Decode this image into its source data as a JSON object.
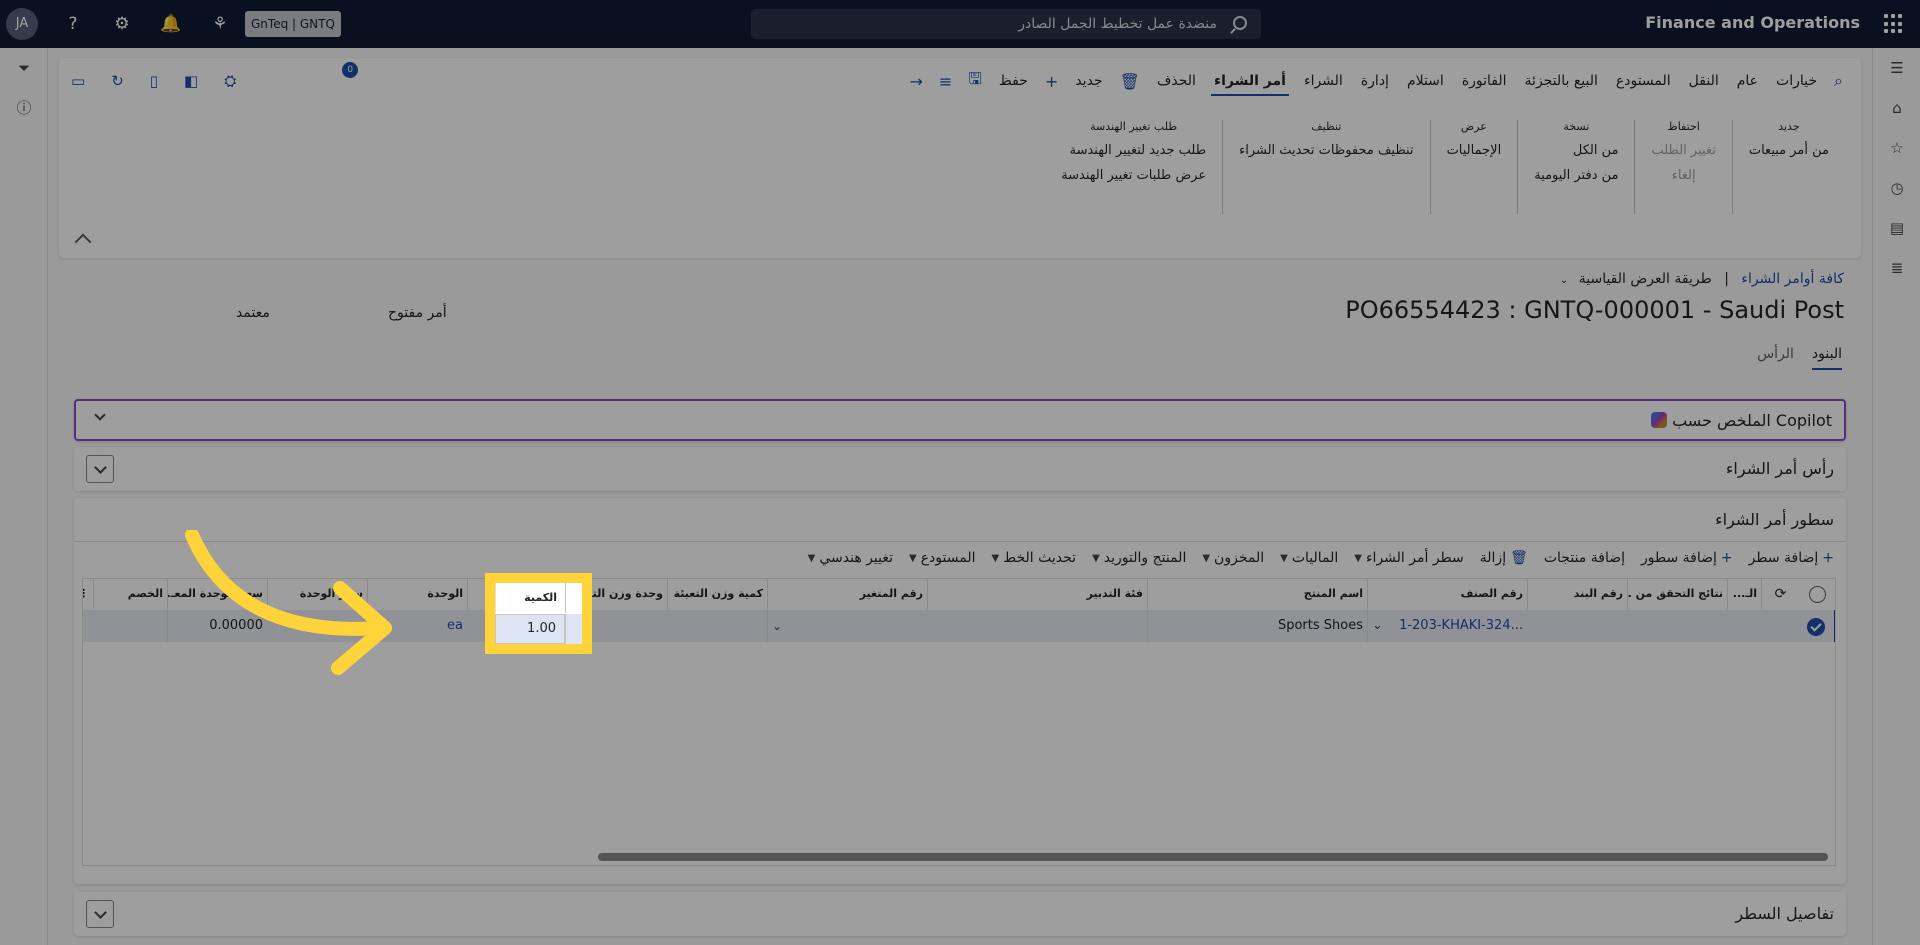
{
  "topbar": {
    "app_title": "Finance and Operations",
    "search_placeholder": "منضدة عمل تخطيط الجمل الصادر",
    "company": "GnTeq | GNTQ",
    "avatar_initials": "JA"
  },
  "action_pane": {
    "tabs": [
      "خيارات",
      "عام",
      "النقل",
      "المستودع",
      "البيع بالتجزئة",
      "الفاتورة",
      "استلام",
      "إدارة",
      "الشراء",
      "أمر الشراء"
    ],
    "active_tab": "أمر الشراء",
    "delete_label": "الحذف",
    "new_label": "جديد",
    "save_label": "حفظ",
    "notification_count": "0",
    "groups": [
      {
        "title": "جديد",
        "items": [
          "من أمر مبيعات"
        ],
        "disabled": []
      },
      {
        "title": "احتفاظ",
        "items": [
          "تغيير الطلب",
          "إلغاء"
        ],
        "disabled": [
          "تغيير الطلب",
          "إلغاء"
        ]
      },
      {
        "title": "نسخة",
        "items": [
          "من الكل",
          "من دفتر اليومية"
        ],
        "disabled": []
      },
      {
        "title": "عرض",
        "items": [
          "الإجماليات"
        ],
        "disabled": []
      },
      {
        "title": "تنظيف",
        "items": [
          "تنظيف محفوظات تحديث الشراء"
        ],
        "disabled": []
      },
      {
        "title": "طلب تغيير الهندسة",
        "items": [
          "طلب جديد لتغيير الهندسة",
          "عرض طلبات تغيير الهندسة"
        ],
        "disabled": []
      }
    ]
  },
  "header": {
    "breadcrumb_link": "كافة أوامر الشراء",
    "breadcrumb_sep": "|",
    "view_label": "طريقة العرض القياسية",
    "title": "PO66554423 : GNTQ-000001 - Saudi Post",
    "status_open": "أمر مفتوح",
    "status_approved": "معتمد",
    "tabs": [
      "البنود",
      "الرأس"
    ]
  },
  "fasttabs": {
    "copilot": "الملخص حسب Copilot",
    "po_header": "رأس أمر الشراء",
    "po_lines": "سطور أمر الشراء",
    "line_details": "تفاصيل السطر"
  },
  "lines_toolbar": [
    {
      "label": "إضافة سطر",
      "icon": "+",
      "dropdown": false
    },
    {
      "label": "إضافة سطور",
      "icon": "+",
      "dropdown": false
    },
    {
      "label": "إضافة منتجات",
      "icon": "",
      "dropdown": false
    },
    {
      "label": "إزالة",
      "icon": "🗑",
      "dropdown": false
    },
    {
      "label": "سطر أمر الشراء",
      "icon": "",
      "dropdown": true
    },
    {
      "label": "الماليات",
      "icon": "",
      "dropdown": true
    },
    {
      "label": "المخزون",
      "icon": "",
      "dropdown": true
    },
    {
      "label": "المنتج والتوريد",
      "icon": "",
      "dropdown": true
    },
    {
      "label": "تحديث الخط",
      "icon": "",
      "dropdown": true
    },
    {
      "label": "المستودع",
      "icon": "",
      "dropdown": true
    },
    {
      "label": "تغيير هندسي",
      "icon": "",
      "dropdown": true
    }
  ],
  "grid": {
    "columns": {
      "col_n": "الـ...",
      "check": "نتائج التحقق من ...",
      "line_no": "رقم البند",
      "item_no": "رقم الصنف",
      "product_name": "اسم المنتج",
      "procurement": "فئة التدبير",
      "variant": "رقم المتغير",
      "pack_qty": "كمية وزن التعبئة",
      "pack_unit": "وحدة وزن التعبئة",
      "quantity": "الكمية",
      "unit": "الوحدة",
      "unit_price": "سعر الوحدة",
      "discount_price": "سعر الوحدة المعـ...",
      "discount": "الخصم"
    },
    "row": {
      "item_no": "1-203-KHAKI-324...",
      "product_name": "Sports Shoes",
      "quantity": "1.00",
      "unit": "ea",
      "discount_price": "0.00000"
    }
  },
  "colors": {
    "topbar": "#0f1b33",
    "accent": "#1f4ea8",
    "highlight": "#ffd43b",
    "copilot_border": "#8a4bc7"
  }
}
